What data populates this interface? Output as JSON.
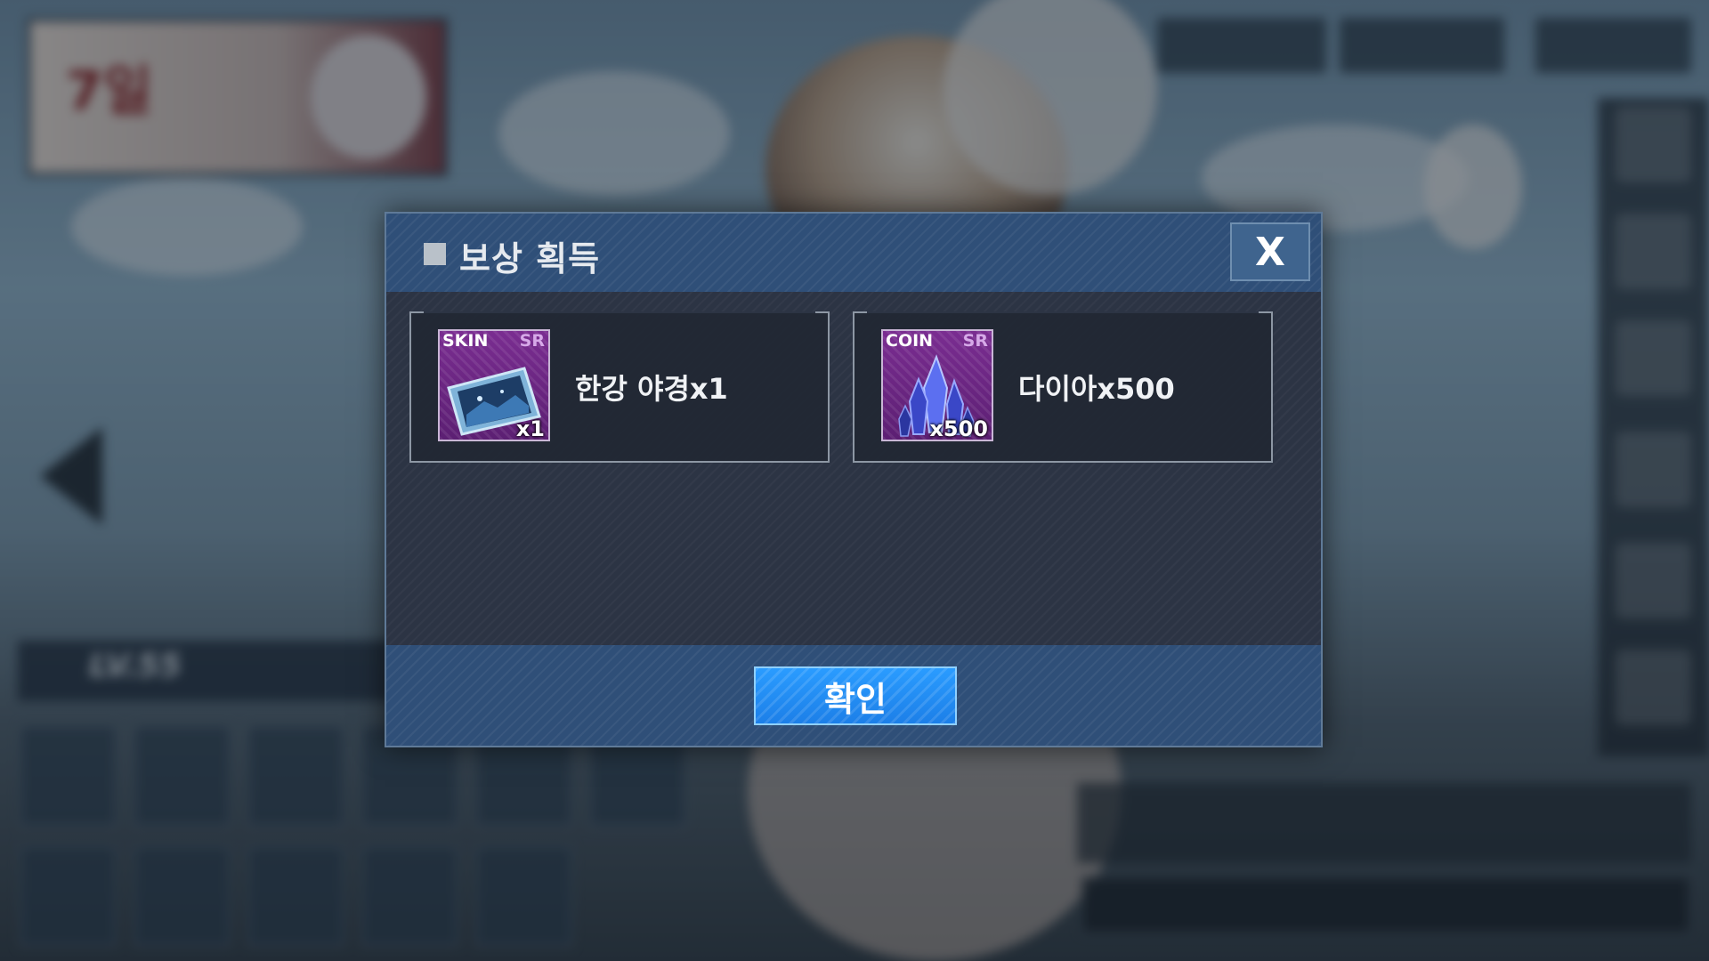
{
  "dialog": {
    "title": "보상 획득",
    "close_label": "X",
    "confirm_label": "확인"
  },
  "rewards": [
    {
      "type_label": "SKIN",
      "rarity": "SR",
      "quantity_label": "x1",
      "name": "한강 야경x1",
      "icon": "skin-card-icon"
    },
    {
      "type_label": "COIN",
      "rarity": "SR",
      "quantity_label": "x500",
      "name": "다이아x500",
      "icon": "diamond-crystal-icon"
    }
  ],
  "background": {
    "banner_text": "7일",
    "level_text": "LV.55"
  },
  "colors": {
    "header": "#2f4f78",
    "body": "#2c3444",
    "confirm": "#1c7fe8",
    "icon_bg": "#6a2682"
  }
}
